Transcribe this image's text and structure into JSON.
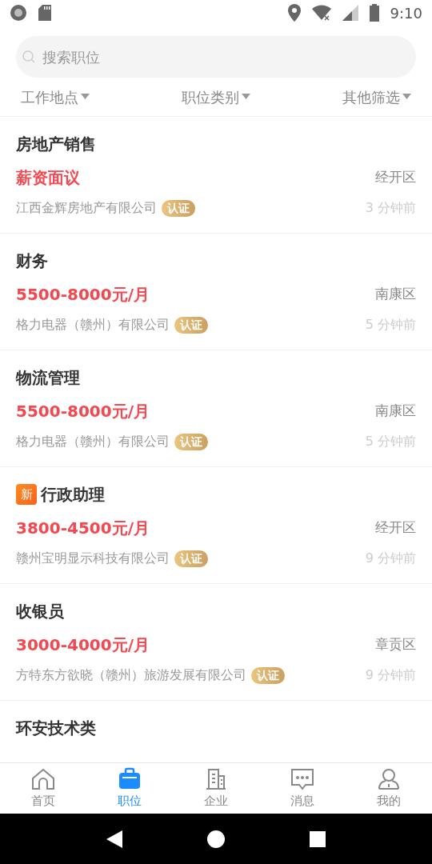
{
  "status_bar": {
    "time": "9:10"
  },
  "search": {
    "placeholder": "搜索职位"
  },
  "filters": [
    {
      "label": "工作地点"
    },
    {
      "label": "职位类别"
    },
    {
      "label": "其他筛选"
    }
  ],
  "jobs": [
    {
      "title": "房地产销售",
      "new": false,
      "salary": "薪资面议",
      "district": "经开区",
      "company": "江西金辉房地产有限公司",
      "verified": true,
      "badge": "认证",
      "time": "3 分钟前"
    },
    {
      "title": "财务",
      "new": false,
      "salary": "5500-8000元/月",
      "district": "南康区",
      "company": "格力电器（赣州）有限公司",
      "verified": true,
      "badge": "认证",
      "time": "5 分钟前"
    },
    {
      "title": "物流管理",
      "new": false,
      "salary": "5500-8000元/月",
      "district": "南康区",
      "company": "格力电器（赣州）有限公司",
      "verified": true,
      "badge": "认证",
      "time": "5 分钟前"
    },
    {
      "title": "行政助理",
      "new": true,
      "new_label": "新",
      "salary": "3800-4500元/月",
      "district": "经开区",
      "company": "赣州宝明显示科技有限公司",
      "verified": true,
      "badge": "认证",
      "time": "9 分钟前"
    },
    {
      "title": "收银员",
      "new": false,
      "salary": "3000-4000元/月",
      "district": "章贡区",
      "company": "方特东方欲晓（赣州）旅游发展有限公司",
      "verified": true,
      "badge": "认证",
      "time": "9 分钟前"
    },
    {
      "title": "环安技术类",
      "new": false
    }
  ],
  "tab_bar": [
    {
      "label": "首页",
      "kind": "home",
      "selected": false
    },
    {
      "label": "职位",
      "kind": "briefcase",
      "selected": true
    },
    {
      "label": "企业",
      "kind": "building",
      "selected": false
    },
    {
      "label": "消息",
      "kind": "message",
      "selected": false
    },
    {
      "label": "我的",
      "kind": "user",
      "selected": false
    }
  ]
}
